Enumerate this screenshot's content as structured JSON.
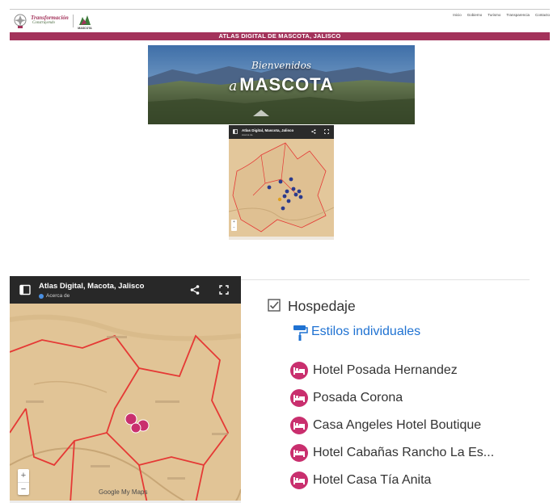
{
  "header": {
    "logo_primary_line1": "Transformación",
    "logo_primary_line2": "Construyendo",
    "logo_secondary": "MASCOTA",
    "nav": [
      "Inicio",
      "Gobierno",
      "Turismo",
      "Transparencia",
      "Contacto"
    ]
  },
  "title_bar": "ATLAS DIGITAL DE MASCOTA, JALISCO",
  "banner": {
    "welcome": "Bienvenidos",
    "prefix": "a",
    "city": "MASCOTA"
  },
  "mini_map": {
    "title": "Atlas Digital, Mascota, Jalisco",
    "subtitle": "Acerca de"
  },
  "big_map": {
    "title": "Atlas Digital, Macota, Jalisco",
    "subtitle": "Acerca de",
    "zoom_in": "+",
    "zoom_out": "−",
    "google_logo": "Google My Maps",
    "icons": [
      "sidebar-icon",
      "share-icon",
      "fullscreen-icon"
    ]
  },
  "legend": {
    "group": "Hospedaje",
    "group_checked": true,
    "style_link": "Estilos individuales",
    "pin_color": "#c92f6e",
    "items": [
      "Hotel Posada Hernandez",
      "Posada Corona",
      "Casa Angeles Hotel Boutique",
      "Hotel Cabañas Rancho La Es...",
      "Hotel Casa Tía Anita"
    ]
  },
  "colors": {
    "brand": "#a3335b",
    "link": "#1f72d2",
    "map_bar": "#282828",
    "boundary": "#e53935"
  }
}
